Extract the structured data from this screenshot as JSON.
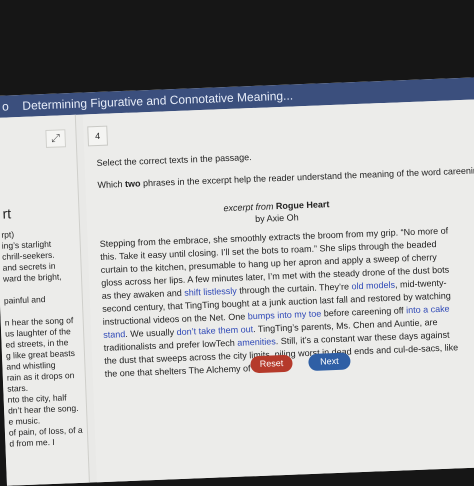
{
  "header": {
    "number": "o",
    "title": "Determining Figurative and Connotative Meaning..."
  },
  "left_panel": {
    "heading": "rt",
    "lines": [
      "rpt)",
      "ing’s starlight",
      "chrill-seekers.",
      "and secrets in",
      "ward the bright,",
      "",
      " painful and",
      "",
      "n hear the song of",
      "us laughter of the",
      "ed streets, in the",
      "g like great beasts",
      "and whistling",
      " rain as it drops on",
      "stars.",
      "nto the city, half",
      "dn’t hear the song.",
      "e music.",
      "of pain, of loss, of a",
      "d from me. I"
    ]
  },
  "question": {
    "number": "4",
    "instruction": "Select the correct texts in the passage.",
    "prompt_before": "Which ",
    "prompt_bold": "two",
    "prompt_after": " phrases in the excerpt help the reader understand the meaning of the word careening?"
  },
  "excerpt": {
    "from_label": "excerpt from ",
    "title": "Rogue Heart",
    "author": "by Axie Oh",
    "segments": [
      {
        "text": "Stepping from the embrace, she smoothly extracts the broom from my grip. “No more of this. Take it easy until closing. I’ll set the bots to roam.” She slips through the beaded curtain to the kitchen, presumable to hang up her apron and apply a sweep of cherry gloss across her lips. A few minutes later, I’m met with the steady drone of the dust bots as they awaken and ",
        "sel": false
      },
      {
        "text": "shift listlessly",
        "sel": true
      },
      {
        "text": " through the curtain. They’re ",
        "sel": false
      },
      {
        "text": "old models",
        "sel": true
      },
      {
        "text": ", mid-twenty-second century, that TingTing bought at a junk auction last fall and restored by watching instructional videos on the Net. One ",
        "sel": false
      },
      {
        "text": "bumps into my toe",
        "sel": true
      },
      {
        "text": " before careening off ",
        "sel": false
      },
      {
        "text": "into a cake stand",
        "sel": true
      },
      {
        "text": ". We usually ",
        "sel": false
      },
      {
        "text": "don’t take them out",
        "sel": true
      },
      {
        "text": ". TingTing’s parents, Ms. Chen and Auntie, are traditionalists and prefer lowTech ",
        "sel": false
      },
      {
        "text": "amenities",
        "sel": true
      },
      {
        "text": ". Still, it’s a constant war these days against the dust that sweeps across the city limits, piling worst in dead ends and cul-de-sacs, like the one that shelters The Alchemy of Dreams.",
        "sel": false
      }
    ]
  },
  "buttons": {
    "reset": "Reset",
    "next": "Next"
  },
  "colors": {
    "header_bg": "#3b4f7d",
    "selectable_text": "#2f49b7",
    "reset_bg": "#b53a2b",
    "next_bg": "#2f5fa5"
  },
  "icons": {
    "expand": "expand-arrows-icon"
  }
}
